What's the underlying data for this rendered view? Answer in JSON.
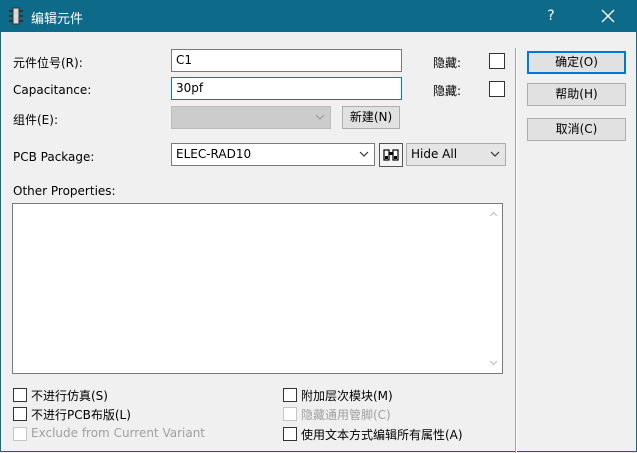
{
  "window": {
    "title": "编辑元件",
    "help_label": "?"
  },
  "fields": {
    "designator_label": "元件位号(R):",
    "designator_value": "C1",
    "designator_hidden_label": "隐藏:",
    "value_label": "Capacitance:",
    "value_value": "30pf",
    "value_hidden_label": "隐藏:",
    "group_label": "组件(E):",
    "group_value": "",
    "new_button": "新建(N)",
    "pcb_package_label": "PCB Package:",
    "pcb_package_value": "ELEC-RAD10",
    "hide_mode_value": "Hide All",
    "other_properties_label": "Other Properties:",
    "other_properties_value": ""
  },
  "buttons": {
    "ok": "确定(O)",
    "help": "帮助(H)",
    "cancel": "取消(C)"
  },
  "options": {
    "exclude_sim": "不进行仿真(S)",
    "exclude_pcb": "不进行PCB布版(L)",
    "exclude_variant": "Exclude from Current Variant",
    "attach_module": "附加层次模块(M)",
    "hide_common_pins": "隐藏通用管脚(C)",
    "edit_as_text": "使用文本方式编辑所有属性(A)"
  }
}
